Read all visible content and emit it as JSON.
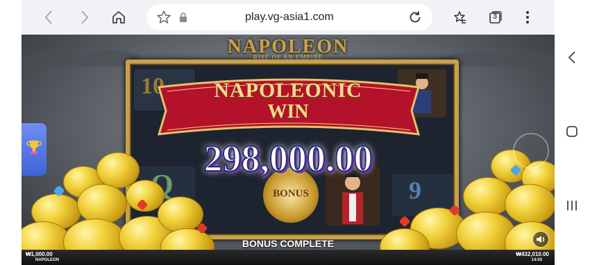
{
  "browser": {
    "url": "play.vg-asia1.com",
    "tab_count": "3"
  },
  "game": {
    "logo_main": "NAPOLEON",
    "logo_sub": "RISE OF AN EMPIRE",
    "banner_line1": "NAPOLEONIC",
    "banner_line2": "WIN",
    "win_amount": "298,000.00",
    "bonus_status": "BONUS COMPLETE",
    "bonus_symbol": "BONUS",
    "reel_symbols": [
      "10",
      "Q",
      "9"
    ],
    "bet_label": "₩1,000.00",
    "game_name": "NAPOLEON",
    "balance_label": "₩432,010.00",
    "clock": "14:03"
  },
  "colors": {
    "banner_red": "#b3122a",
    "gold": "#c9a24a",
    "url_bar": "#f1f2f5",
    "trophy_tab": "#4d6fe0"
  },
  "icons": [
    "back-arrow-icon",
    "forward-arrow-icon",
    "home-icon",
    "star-icon",
    "lock-icon",
    "reload-icon",
    "bookmarks-icon",
    "tabs-icon",
    "more-vertical-icon",
    "trophy-icon",
    "sound-icon",
    "rail-back-icon",
    "rail-home-icon",
    "rail-recents-icon"
  ]
}
